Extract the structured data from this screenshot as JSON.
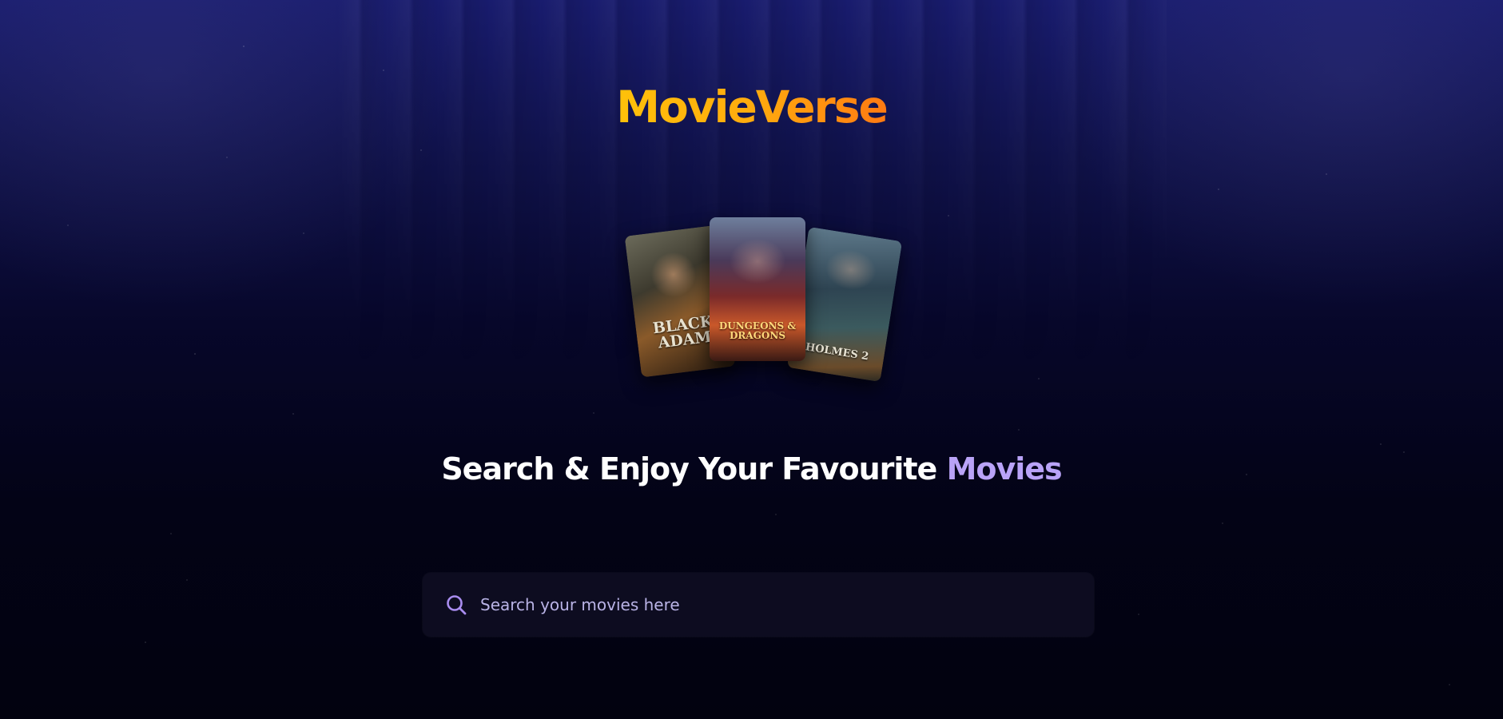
{
  "app": {
    "logo_part1": "Movie",
    "logo_part2": "Verse"
  },
  "hero": {
    "posters": [
      {
        "title": "BLACK ADAM"
      },
      {
        "title": "DUNGEONS & DRAGONS"
      },
      {
        "title": "HOLMES 2"
      }
    ],
    "headline_main": "Search & Enjoy Your Favourite ",
    "headline_accent": "Movies"
  },
  "search": {
    "placeholder": "Search your movies here",
    "value": ""
  },
  "colors": {
    "logo_gradient_start": "#ffc10a",
    "logo_gradient_end": "#ff7a12",
    "accent_purple": "#b9a3f7",
    "search_background": "#0d0c20",
    "page_background": "#04041a"
  },
  "icons": {
    "search": "search-icon"
  }
}
